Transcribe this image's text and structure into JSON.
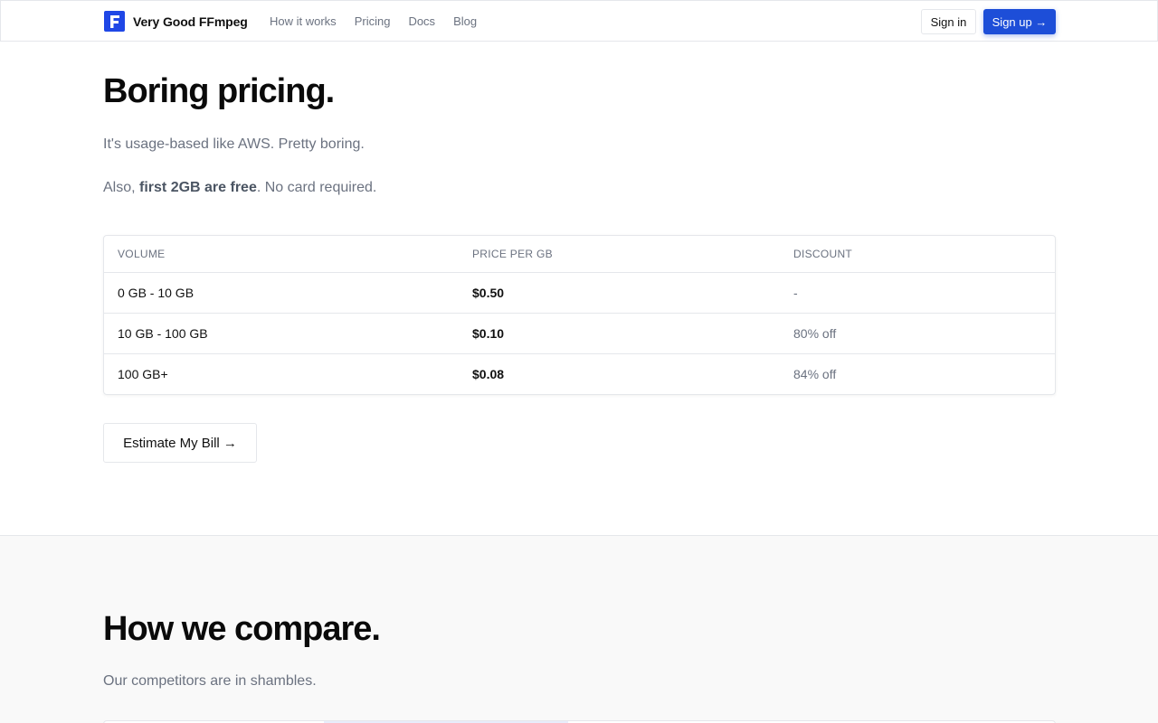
{
  "nav": {
    "brand": "Very Good FFmpeg",
    "logo_letter": "F",
    "links": [
      "How it works",
      "Pricing",
      "Docs",
      "Blog"
    ],
    "signin": "Sign in",
    "signup": "Sign up →"
  },
  "pricing": {
    "title": "Boring pricing.",
    "subtitle": "It's usage-based like AWS. Pretty boring.",
    "free_prefix": "Also, ",
    "free_bold": "first 2GB are free",
    "free_suffix": ". No card required.",
    "table": {
      "headers": [
        "VOLUME",
        "PRICE PER GB",
        "DISCOUNT"
      ],
      "rows": [
        {
          "volume": "0 GB - 10 GB",
          "price": "$0.50",
          "discount": "-"
        },
        {
          "volume": "10 GB - 100 GB",
          "price": "$0.10",
          "discount": "80% off"
        },
        {
          "volume": "100 GB+",
          "price": "$0.08",
          "discount": "84% off"
        }
      ]
    },
    "estimate_button": "Estimate My Bill →"
  },
  "compare": {
    "title": "How we compare.",
    "subtitle": "Our competitors are in shambles."
  },
  "colors": {
    "brand_blue": "#1d4ed8",
    "text": "#111111",
    "muted": "#6b7280",
    "border": "#e5e7eb"
  }
}
